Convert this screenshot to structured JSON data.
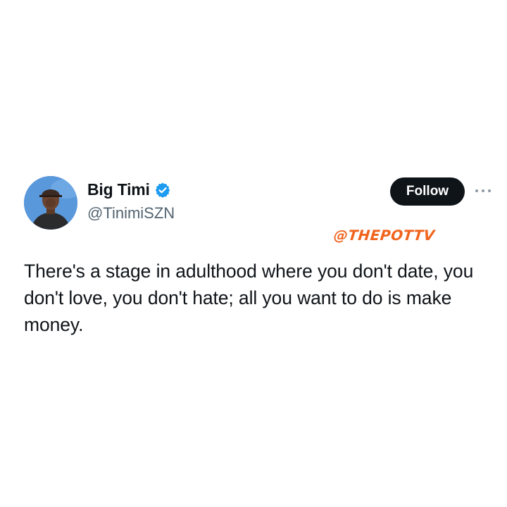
{
  "tweet": {
    "display_name": "Big Timi",
    "handle": "@TinimiSZN",
    "follow_label": "Follow",
    "text": "There's a stage in adulthood where you don't date, you don't love, you don't hate; all you want to do is make money.",
    "watermark": "@THEPOTTV",
    "verified": true,
    "icons": {
      "verified": "verified-badge-icon",
      "more": "more-options-icon"
    }
  },
  "colors": {
    "accent_verified": "#1d9bf0",
    "follow_button_bg": "#0f1419",
    "text_primary": "#0f1419",
    "text_secondary": "#536471",
    "watermark": "#f0641e",
    "background": "#ffffff"
  }
}
